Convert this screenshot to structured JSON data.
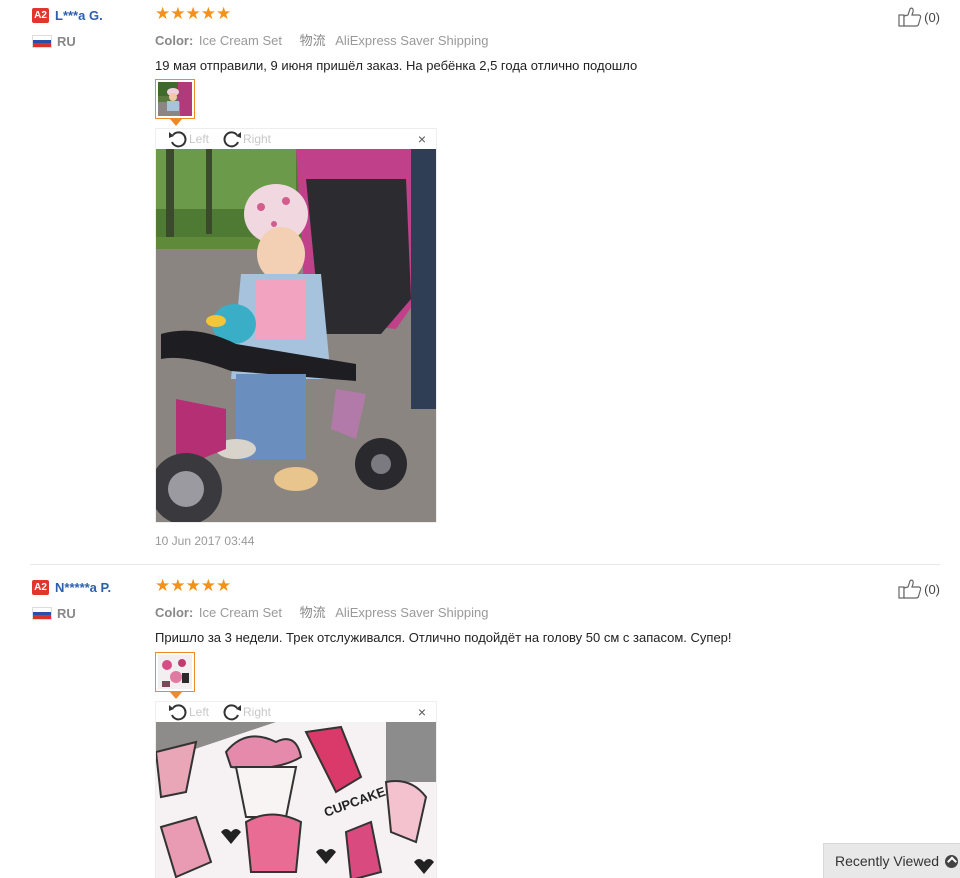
{
  "reviews": [
    {
      "level": "A2",
      "name": "L***a G.",
      "country": "RU",
      "stars": "★★★★★",
      "color_label": "Color:",
      "color_value": "Ice Cream Set",
      "shipping_label": "物流",
      "shipping_value": "AliExpress Saver Shipping",
      "text": "19 мая отправили, 9 июня пришёл заказ. На ребёнка 2,5 года отлично подошло",
      "rotate_left": "Left",
      "rotate_right": "Right",
      "close": "×",
      "date": "10 Jun 2017 03:44",
      "helpful_count": "(0)"
    },
    {
      "level": "A2",
      "name": "N*****a P.",
      "country": "RU",
      "stars": "★★★★★",
      "color_label": "Color:",
      "color_value": "Ice Cream Set",
      "shipping_label": "物流",
      "shipping_value": "AliExpress Saver Shipping",
      "text": "Пришло за 3 недели. Трек отслуживался. Отлично подойдёт на голову 50 см с запасом. Супер!",
      "rotate_left": "Left",
      "rotate_right": "Right",
      "close": "×",
      "helpful_count": "(0)"
    }
  ],
  "recently_viewed": "Recently Viewed",
  "colors": {
    "level_badge": "#e0362d",
    "username": "#2c5fae",
    "stars": "#f3921b",
    "thumb_border": "#f0892a"
  }
}
